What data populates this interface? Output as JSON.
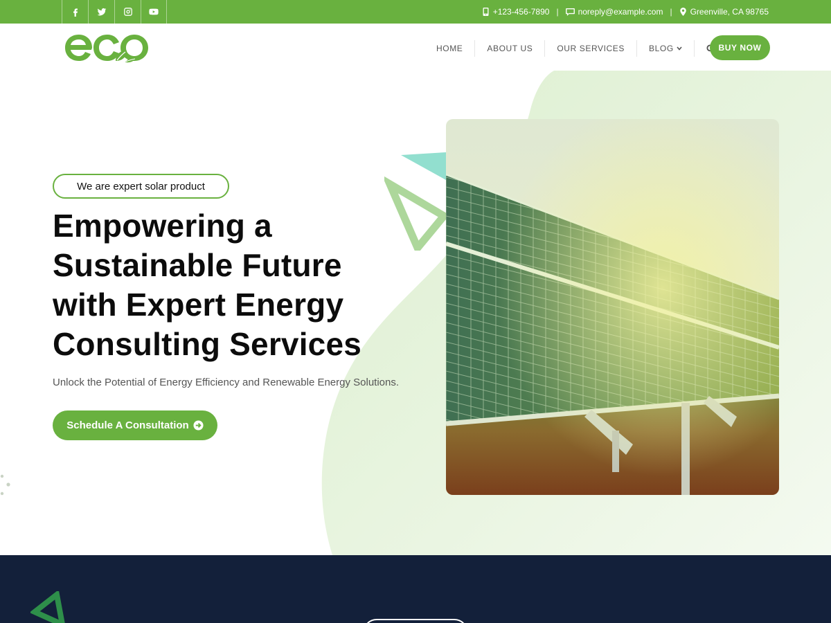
{
  "topbar": {
    "social": [
      {
        "icon": "facebook-icon"
      },
      {
        "icon": "twitter-icon"
      },
      {
        "icon": "instagram-icon"
      },
      {
        "icon": "youtube-icon"
      }
    ],
    "phone": "+123-456-7890",
    "email": "noreply@example.com",
    "location": "Greenville, CA 98765",
    "separator": "|"
  },
  "header": {
    "logo_text": "eco",
    "nav": [
      {
        "label": "HOME"
      },
      {
        "label": "ABOUT US"
      },
      {
        "label": "OUR SERVICES"
      },
      {
        "label": "BLOG"
      }
    ],
    "buy_label": "BUY NOW"
  },
  "hero": {
    "tagline": "We are expert solar product",
    "headline_lines": [
      "Empowering a",
      "Sustainable Future",
      "with Expert Energy",
      "Consulting Services"
    ],
    "subtext": "Unlock the Potential of Energy Efficiency and Renewable Energy Solutions.",
    "cta_label": "Schedule A Consultation"
  },
  "colors": {
    "brand_green": "#69b13f",
    "dark_navy": "#13203a",
    "light_green": "#e3f1d8"
  }
}
